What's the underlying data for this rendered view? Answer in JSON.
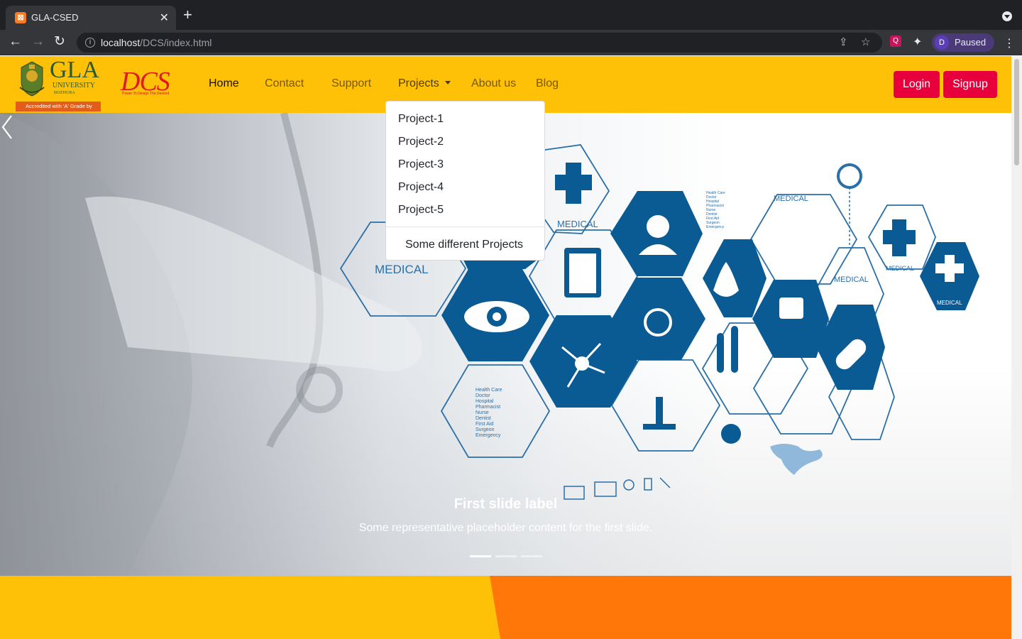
{
  "browser": {
    "tab_title": "GLA-CSED",
    "tab_favicon": "⊠",
    "url_host": "localhost",
    "url_path": "/DCS/index.html",
    "profile_initial": "D",
    "profile_status": "Paused"
  },
  "brand": {
    "gla_name": "GLA",
    "gla_university": "UNIVERSITY",
    "gla_city": "MATHURA",
    "gla_accreditation": "Accredited with 'A' Grade by NAAC",
    "dcs_name": "DCS",
    "dcs_tagline": "Power To Design The Desired"
  },
  "nav": {
    "home": "Home",
    "contact": "Contact",
    "support": "Support",
    "projects": "Projects",
    "about": "About us",
    "blog": "Blog",
    "login": "Login",
    "signup": "Signup"
  },
  "projects_menu": {
    "items": [
      "Project-1",
      "Project-2",
      "Project-3",
      "Project-4",
      "Project-5"
    ],
    "extra": "Some different Projects"
  },
  "carousel": {
    "title": "First slide label",
    "text": "Some representative placeholder content for the first slide.",
    "slide_count": 3,
    "active_index": 0,
    "image_labels": {
      "medical": "MEDICAL",
      "health_list": [
        "Health Care",
        "Doctor",
        "Hospital",
        "Pharmacist",
        "Nurse",
        "Dentist",
        "First Aid",
        "Surgeon",
        "Emergency"
      ]
    }
  },
  "colors": {
    "navbar": "#ffc107",
    "button": "#e8003d",
    "band_orange": "#ff7709",
    "medical_blue": "#0a5a94"
  }
}
